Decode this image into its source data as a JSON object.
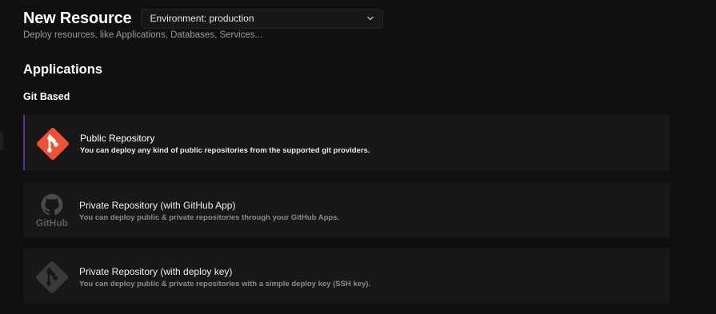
{
  "header": {
    "title": "New Resource",
    "subtitle": "Deploy resources, like Applications, Databases, Services..."
  },
  "environment_select": {
    "value": "Environment: production"
  },
  "sections": {
    "applications": "Applications",
    "git_based": "Git Based"
  },
  "cards": [
    {
      "title": "Public Repository",
      "description": "You can deploy any kind of public repositories from the supported git providers.",
      "icon": "git-icon",
      "accent": "#f05133"
    },
    {
      "title": "Private Repository (with GitHub App)",
      "description": "You can deploy public & private repositories through your GitHub Apps.",
      "icon": "github-icon",
      "icon_label": "GitHub"
    },
    {
      "title": "Private Repository (with deploy key)",
      "description": "You can deploy public & private repositories with a simple deploy key (SSH key).",
      "icon": "git-icon"
    }
  ],
  "colors": {
    "background": "#101010",
    "card": "#181818",
    "active_border": "#5a2d9c",
    "git_orange": "#f05133"
  }
}
